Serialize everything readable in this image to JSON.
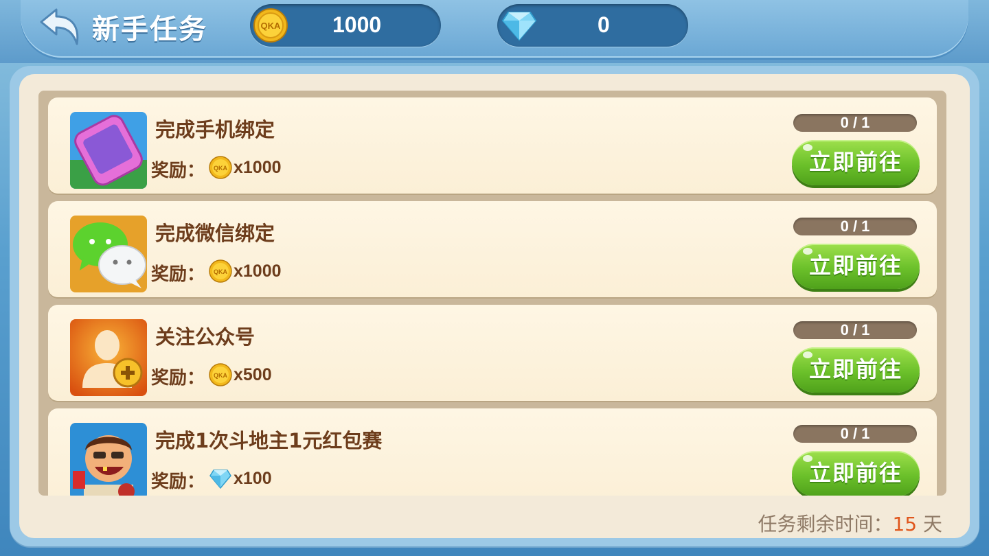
{
  "header": {
    "title": "新手任务",
    "gold_amount": "1000",
    "gem_amount": "0",
    "back_icon": "back-arrow-icon",
    "gold_icon": "qka-coin-icon",
    "gem_icon": "diamond-icon"
  },
  "tasks": [
    {
      "title": "完成手机绑定",
      "reward_label": "奖励：",
      "reward_icon": "qka-coin-icon",
      "reward_amount": "x1000",
      "progress": "0 / 1",
      "button": "立即前往",
      "icon": "phone-icon"
    },
    {
      "title": "完成微信绑定",
      "reward_label": "奖励：",
      "reward_icon": "qka-coin-icon",
      "reward_amount": "x1000",
      "progress": "0 / 1",
      "button": "立即前往",
      "icon": "wechat-icon"
    },
    {
      "title": "关注公众号",
      "reward_label": "奖励：",
      "reward_icon": "qka-coin-icon",
      "reward_amount": "x500",
      "progress": "0 / 1",
      "button": "立即前往",
      "icon": "add-user-icon"
    },
    {
      "title": "完成1次斗地主1元红包赛",
      "reward_label": "奖励：",
      "reward_icon": "diamond-icon",
      "reward_amount": "x100",
      "progress": "0 / 1",
      "button": "立即前往",
      "icon": "landlord-character-icon"
    }
  ],
  "footer": {
    "label": "任务剩余时间：",
    "days": "15",
    "unit": " 天"
  },
  "colors": {
    "accent_green": "#6bc02a",
    "text_brown": "#6d3d1c",
    "days_orange": "#e0561c"
  }
}
